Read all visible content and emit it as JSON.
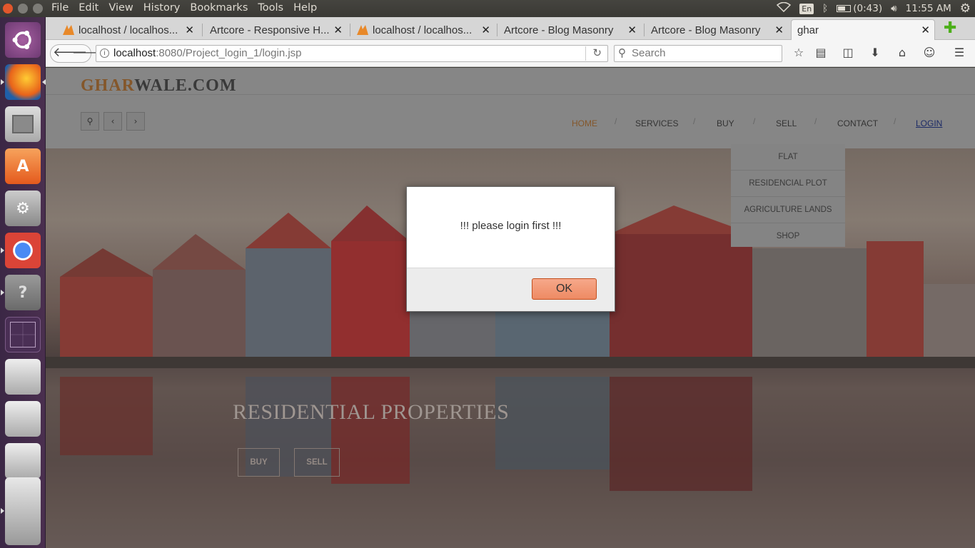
{
  "menubar": {
    "file": "File",
    "edit": "Edit",
    "view": "View",
    "history": "History",
    "bookmarks": "Bookmarks",
    "tools": "Tools",
    "help": "Help"
  },
  "tray": {
    "lang": "En",
    "battery": "(0:43)",
    "time": "11:55 AM"
  },
  "tabs": [
    {
      "label": "localhost / localhos..."
    },
    {
      "label": "Artcore - Responsive H..."
    },
    {
      "label": "localhost / localhos..."
    },
    {
      "label": "Artcore - Blog Masonry"
    },
    {
      "label": "Artcore - Blog Masonry"
    },
    {
      "label": "ghar"
    }
  ],
  "url": {
    "host": "localhost",
    "rest": ":8080/Project_login_1/login.jsp"
  },
  "search": {
    "placeholder": "Search"
  },
  "site": {
    "logo_a": "GHAR",
    "logo_b": "WALE.COM",
    "nav": {
      "home": "HOME",
      "services": "SERVICES",
      "buy": "BUY",
      "sell": "SELL",
      "contact": "CONTACT",
      "login": "LOGIN",
      "sep": "/"
    },
    "sell_menu": [
      "FLAT",
      "RESIDENCIAL PLOT",
      "AGRICULTURE LANDS",
      "SHOP"
    ],
    "hero_title": "RESIDENTIAL PROPERTIES",
    "hero_buy": "BUY",
    "hero_sell": "SELL"
  },
  "dialog": {
    "message": "!!!  please login first !!!",
    "ok": "OK"
  },
  "colors": {
    "accent": "#e8874f",
    "home_active": "#8a5a2a",
    "launcher": "#3b2745"
  }
}
